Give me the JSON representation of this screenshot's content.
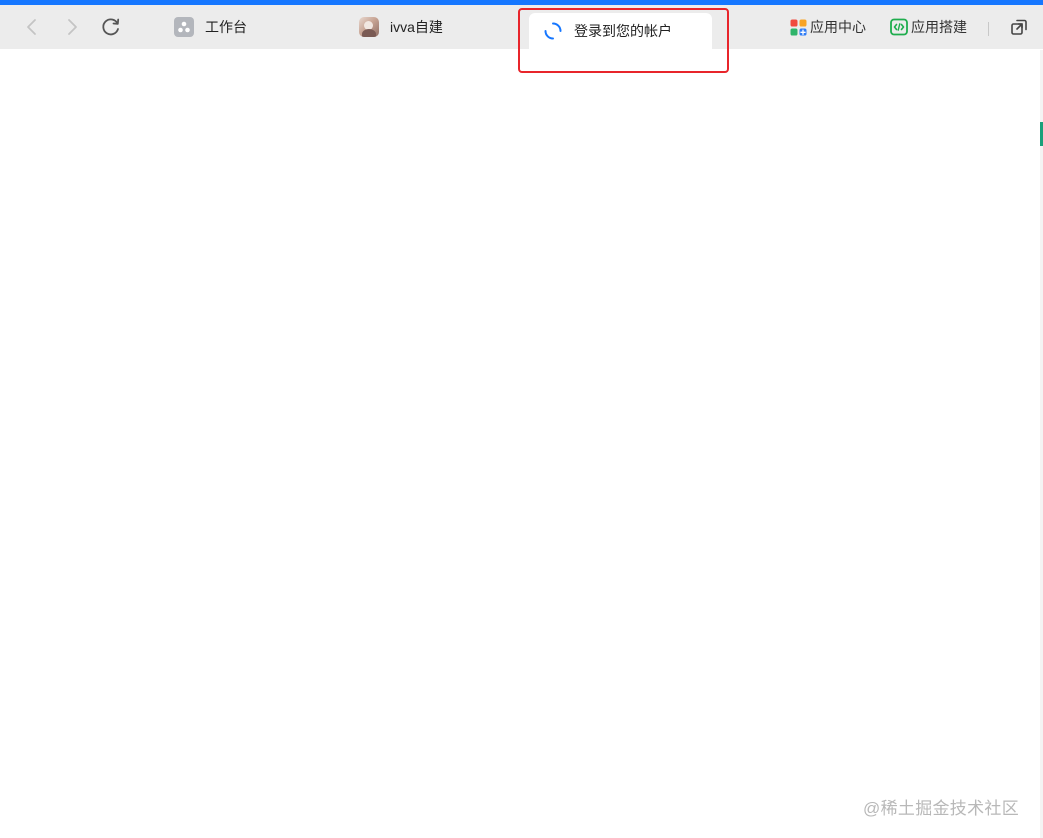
{
  "browser": {
    "accent_color": "#1677ff",
    "toolbar_color": "#ececec"
  },
  "nav": {
    "back_icon": "chevron-left-icon",
    "forward_icon": "chevron-right-icon",
    "refresh_icon": "refresh-icon"
  },
  "tabs": [
    {
      "label": "工作台",
      "icon": "workbench-icon"
    },
    {
      "label": "ivva自建",
      "icon": "avatar-icon"
    },
    {
      "label": "登录到您的帐户",
      "icon": "loading-spinner-icon",
      "active": true
    }
  ],
  "toolbar_right": {
    "app_center": {
      "label": "应用中心",
      "icon": "app-grid-icon"
    },
    "app_builder": {
      "label": "应用搭建",
      "icon": "code-icon"
    },
    "popout_icon": "open-in-new-window-icon"
  },
  "annotation": {
    "color": "#e8252b"
  },
  "watermark": {
    "text": "@稀土掘金技术社区"
  }
}
